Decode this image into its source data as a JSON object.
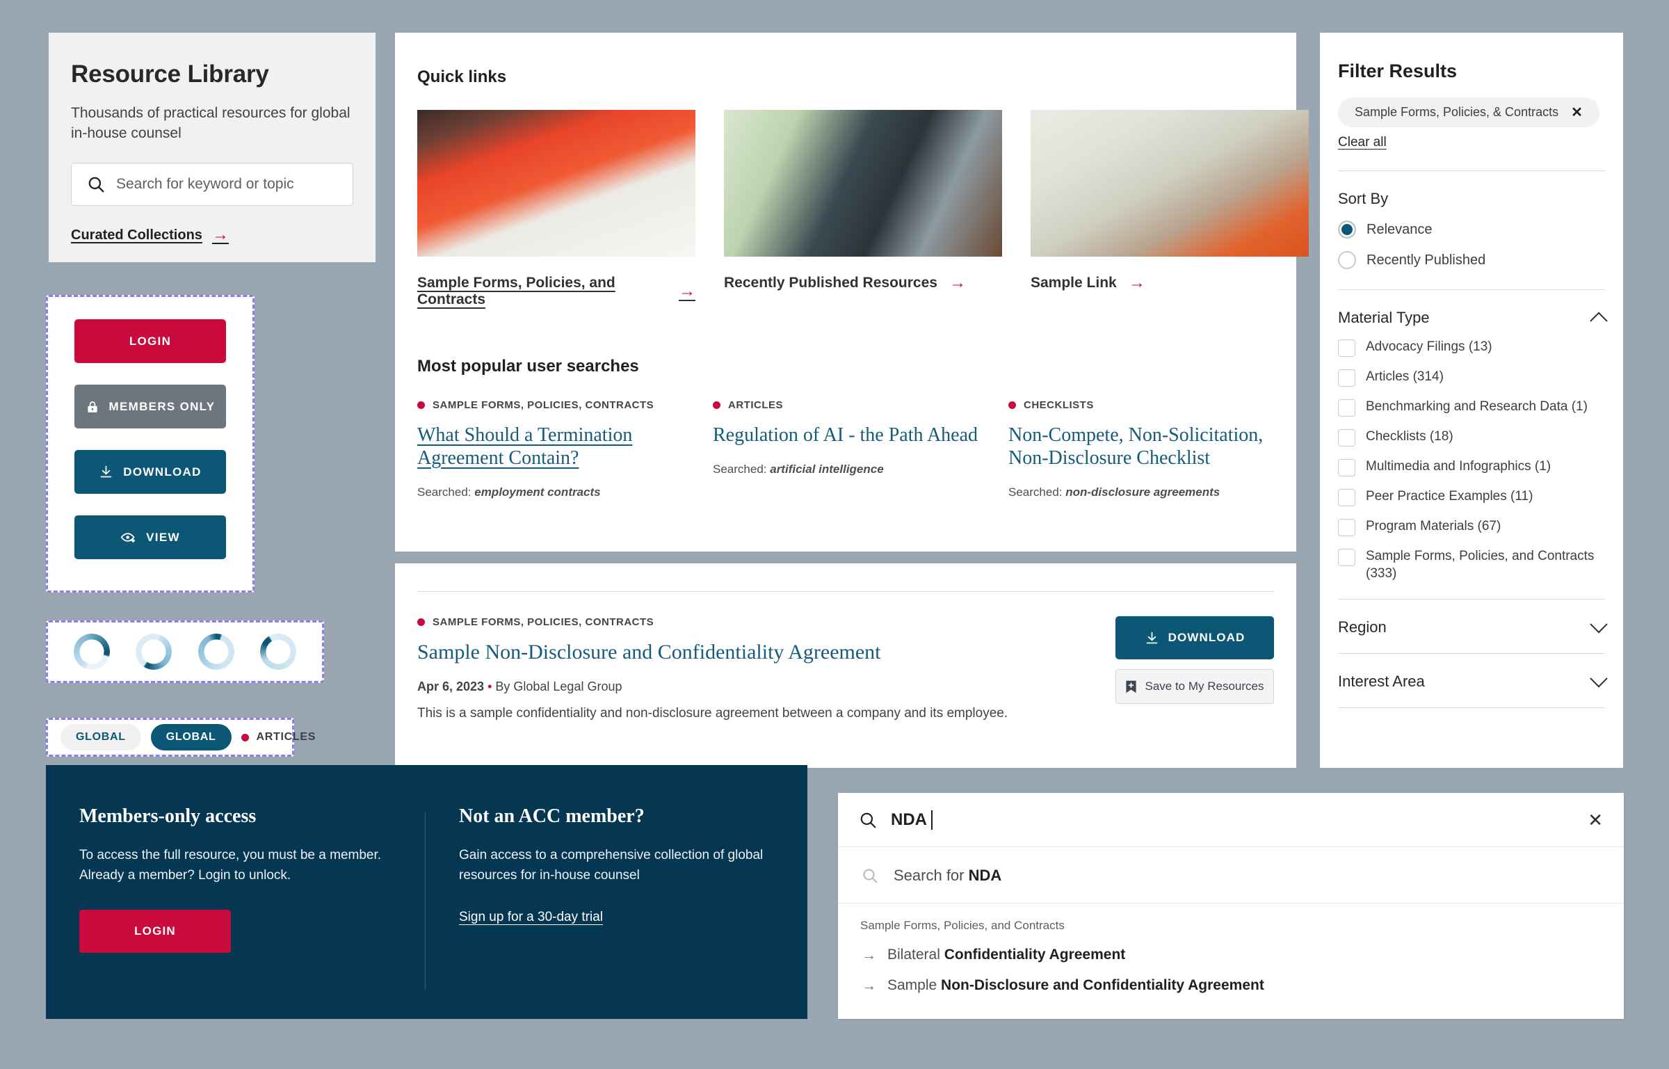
{
  "hero": {
    "title": "Resource Library",
    "subtitle": "Thousands of practical resources for global in-house counsel",
    "search_placeholder": "Search for keyword or topic",
    "curated_link": "Curated Collections"
  },
  "buttons": {
    "login": "LOGIN",
    "members_only": "MEMBERS ONLY",
    "download": "DOWNLOAD",
    "view": "VIEW"
  },
  "tags": {
    "pill_light": "GLOBAL",
    "pill_teal": "GLOBAL",
    "category": "ARTICLES"
  },
  "quick_links": {
    "heading": "Quick links",
    "items": [
      {
        "label": "Sample Forms, Policies, and Contracts"
      },
      {
        "label": "Recently Published Resources"
      },
      {
        "label": "Sample Link"
      }
    ]
  },
  "popular": {
    "heading": "Most popular user searches",
    "items": [
      {
        "category": "SAMPLE FORMS, POLICIES, CONTRACTS",
        "title": "What Should a Termination Agreement Contain?",
        "searched_label": "Searched:",
        "searched_term": "employment contracts"
      },
      {
        "category": "ARTICLES",
        "title": "Regulation of AI - the Path Ahead",
        "searched_label": "Searched:",
        "searched_term": "artificial intelligence"
      },
      {
        "category": "CHECKLISTS",
        "title": "Non-Compete, Non-Solicitation, Non-Disclosure Checklist",
        "searched_label": "Searched:",
        "searched_term": "non-disclosure agreements"
      }
    ]
  },
  "result": {
    "category": "SAMPLE FORMS, POLICIES, CONTRACTS",
    "title": "Sample Non-Disclosure and Confidentiality Agreement",
    "date": "Apr 6, 2023",
    "byline": "By Global Legal Group",
    "description": "This is a sample confidentiality and non-disclosure agreement between a company and its employee.",
    "download_label": "DOWNLOAD",
    "save_label": "Save to My Resources"
  },
  "filters": {
    "heading": "Filter Results",
    "active_chip": "Sample Forms, Policies, & Contracts",
    "clear_all": "Clear all",
    "sort_by": {
      "heading": "Sort By",
      "options": [
        {
          "label": "Relevance",
          "selected": true
        },
        {
          "label": "Recently Published",
          "selected": false
        }
      ]
    },
    "material_type": {
      "heading": "Material Type",
      "expanded": true,
      "options": [
        {
          "label": "Advocacy Filings (13)"
        },
        {
          "label": "Articles (314)"
        },
        {
          "label": "Benchmarking and Research Data (1)"
        },
        {
          "label": "Checklists (18)"
        },
        {
          "label": "Multimedia and Infographics (1)"
        },
        {
          "label": "Peer Practice Examples (11)"
        },
        {
          "label": "Program Materials (67)"
        },
        {
          "label": "Sample Forms, Policies, and Contracts (333)"
        }
      ]
    },
    "region": {
      "heading": "Region",
      "expanded": false
    },
    "interest_area": {
      "heading": "Interest Area",
      "expanded": false
    }
  },
  "members": {
    "left_title": "Members-only access",
    "left_body": "To access the full resource, you must be a member. Already a member? Login to unlock.",
    "login_label": "LOGIN",
    "right_title": "Not an ACC member?",
    "right_body": "Gain access to a comprehensive collection of global resources for in-house counsel",
    "trial_link": "Sign up for a 30-day trial"
  },
  "typeahead": {
    "query": "NDA",
    "search_for_prefix": "Search for ",
    "search_for_term": "NDA",
    "group_label": "Sample Forms, Policies, and Contracts",
    "items": [
      {
        "prefix": "Bilateral ",
        "bold": "Confidentiality Agreement"
      },
      {
        "prefix": "Sample ",
        "bold": "Non-Disclosure and Confidentiality Agreement"
      }
    ]
  },
  "colors": {
    "crimson": "#c80a3c",
    "teal": "#0b5775",
    "navy": "#063752",
    "grey": "#6d757e",
    "page_bg": "#9aa6b1"
  }
}
